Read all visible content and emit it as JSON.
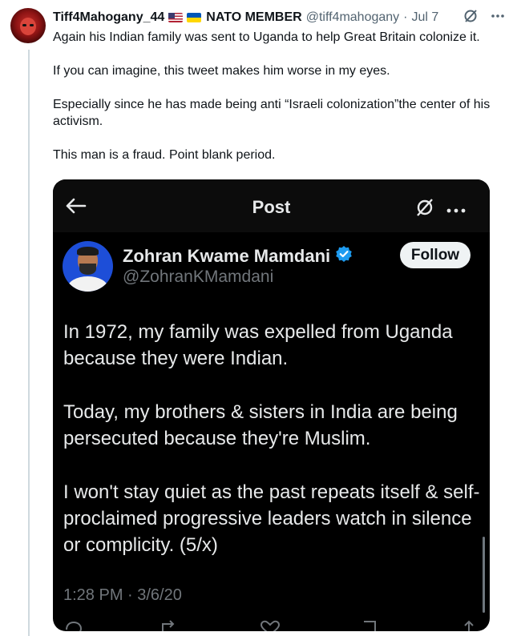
{
  "tweet": {
    "author_name": "Tiff4Mahogany_44",
    "badge_text": "NATO MEMBER",
    "handle": "@tiff4mahogany",
    "separator": "·",
    "date": "Jul 7",
    "paragraphs": [
      "Again his Indian family was sent to Uganda to help Great Britain colonize it.",
      "If you can imagine, this tweet makes him worse in my eyes.",
      "Especially since he has made being anti “Israeli colonization”the center of his activism.",
      "This man is a fraud. Point blank period."
    ],
    "icons": [
      "grok-icon",
      "more-icon",
      "us-flag-icon",
      "ukraine-flag-icon"
    ]
  },
  "embedded": {
    "header_title": "Post",
    "user_name": "Zohran Kwame Mamdani",
    "user_handle": "@ZohranKMamdani",
    "follow_label": "Follow",
    "paragraphs": [
      "In 1972, my family was expelled from Uganda because they were Indian.",
      "Today, my brothers & sisters in India are being persecuted because they're Muslim.",
      "I won't stay quiet as the past repeats itself & self-proclaimed progressive leaders watch in silence or complicity. (5/x)"
    ],
    "timestamp": "1:28 PM · 3/6/20",
    "icons": [
      "back-arrow-icon",
      "grok-icon",
      "more-icon",
      "verified-badge-icon",
      "reply-icon",
      "repost-icon",
      "like-icon",
      "bookmark-icon",
      "share-icon"
    ],
    "colors": {
      "background": "#000000",
      "verified": "#1d9bf0",
      "avatar_bg": "#1d4ed8"
    }
  }
}
